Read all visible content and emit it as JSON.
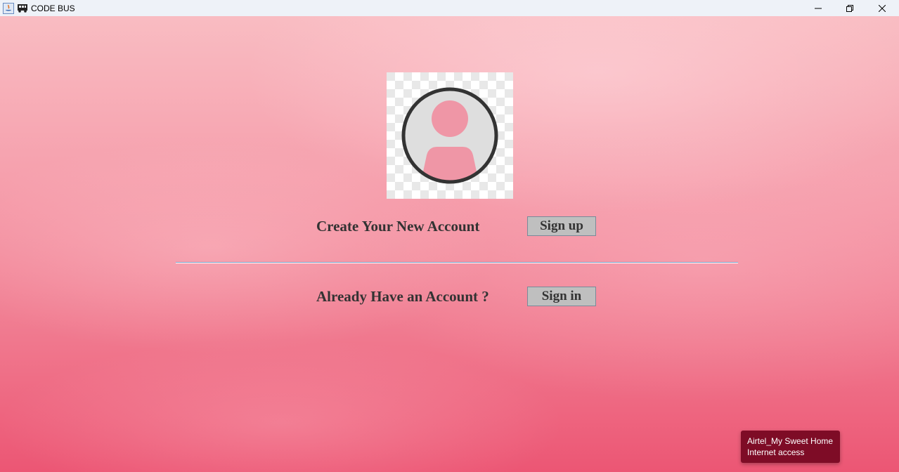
{
  "window": {
    "title": "CODE BUS",
    "app_icon": "java-icon",
    "bus_icon": "bus-icon"
  },
  "main": {
    "create_label": "Create Your New Account",
    "signup_label": "Sign up",
    "signin_prompt": "Already Have an Account ?",
    "signin_label": "Sign in"
  },
  "toast": {
    "network": "Airtel_My Sweet Home",
    "status": "Internet access"
  },
  "colors": {
    "button": "#bfbfbf",
    "text": "#333333",
    "toast": "#7e0c26",
    "avatar_pink": "#ef96a6"
  }
}
